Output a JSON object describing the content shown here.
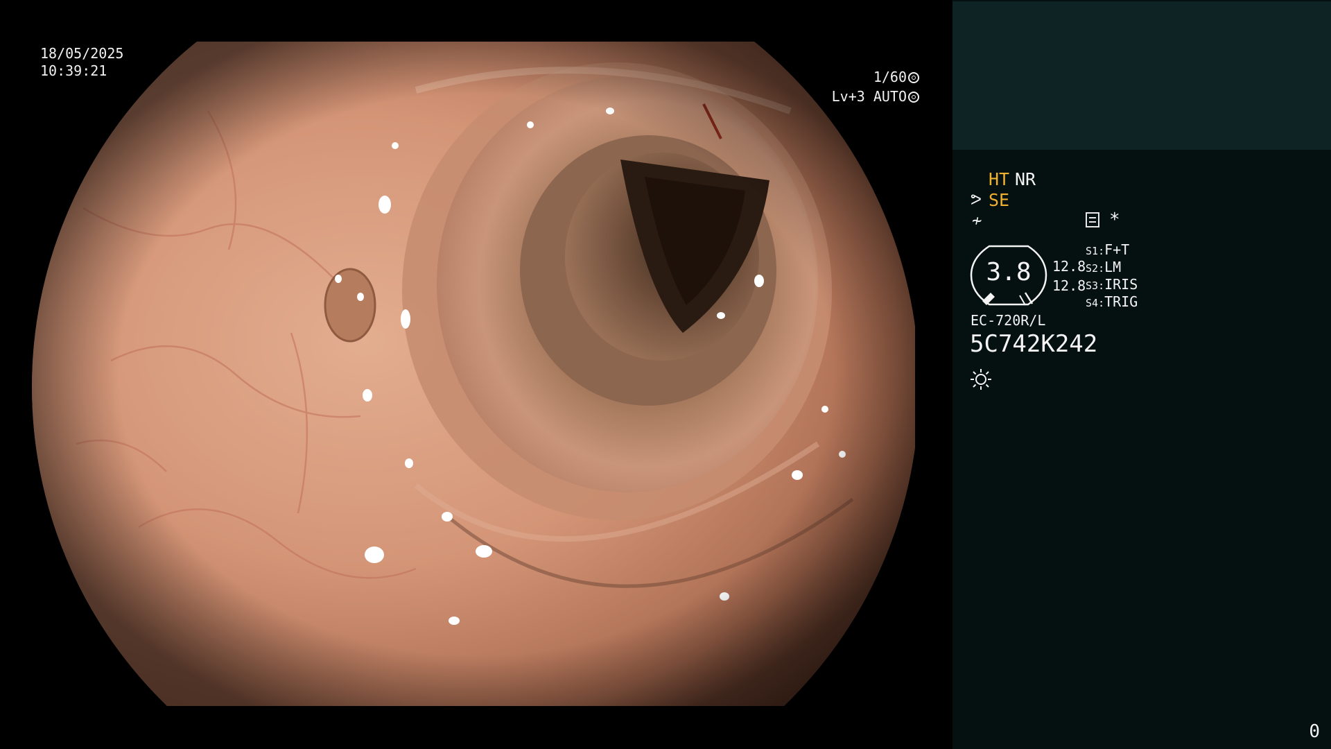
{
  "video": {
    "date": "18/05/2025",
    "time": "10:39:21",
    "shutter": "1/60",
    "level": "Lv+3 AUTO"
  },
  "panel": {
    "mode_ht": "HT",
    "mode_nr": "NR",
    "mode_se": "SE",
    "gauge_value": "3.8",
    "value_1": "12.8",
    "value_2": "12.8",
    "switches": [
      {
        "key": "S1",
        "value": "F+T"
      },
      {
        "key": "S2",
        "value": "LM"
      },
      {
        "key": "S3",
        "value": "IRIS"
      },
      {
        "key": "S4",
        "value": "TRIG"
      }
    ],
    "scope_model": "EC-720R/L",
    "scope_serial": "5C742K242",
    "page_counter": "0"
  },
  "colors": {
    "panel_bg": "#041110",
    "panel_header_bg": "#0d2324",
    "highlight": "#f0b030",
    "text": "#f4f4f4"
  },
  "icons": {
    "shutter": "aperture-icon",
    "level": "iris-icon",
    "se": "scope-tip-icon",
    "freeze": "freeze-icon",
    "memo": "memo-icon",
    "asterisk": "asterisk-icon",
    "light": "light-icon"
  }
}
